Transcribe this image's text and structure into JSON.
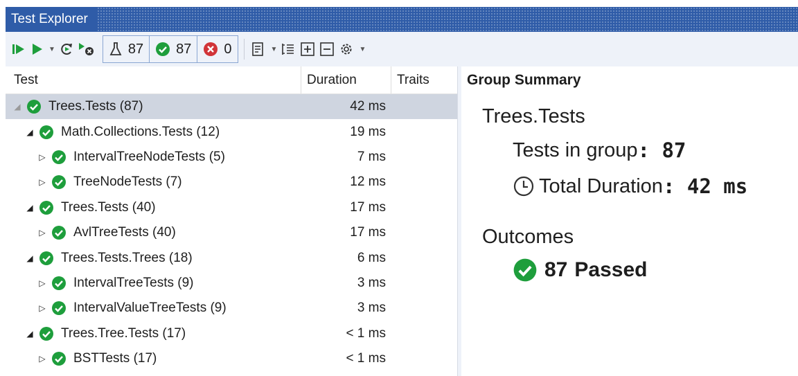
{
  "window": {
    "title": "Test Explorer"
  },
  "toolbar": {
    "counters": {
      "total": "87",
      "passed": "87",
      "failed": "0"
    }
  },
  "tree": {
    "columns": {
      "test": "Test",
      "duration": "Duration",
      "traits": "Traits"
    },
    "rows": [
      {
        "name": "Trees.Tests (87)",
        "duration": "42 ms"
      },
      {
        "name": "Math.Collections.Tests (12)",
        "duration": "19 ms"
      },
      {
        "name": "IntervalTreeNodeTests (5)",
        "duration": "7 ms"
      },
      {
        "name": "TreeNodeTests (7)",
        "duration": "12 ms"
      },
      {
        "name": "Trees.Tests (40)",
        "duration": "17 ms"
      },
      {
        "name": "AvlTreeTests (40)",
        "duration": "17 ms"
      },
      {
        "name": "Trees.Tests.Trees (18)",
        "duration": "6 ms"
      },
      {
        "name": "IntervalTreeTests (9)",
        "duration": "3 ms"
      },
      {
        "name": "IntervalValueTreeTests (9)",
        "duration": "3 ms"
      },
      {
        "name": "Trees.Tree.Tests (17)",
        "duration": "< 1 ms"
      },
      {
        "name": "BSTTests (17)",
        "duration": "< 1 ms"
      }
    ]
  },
  "summary": {
    "header": "Group Summary",
    "group_name": "Trees.Tests",
    "tests_label": "Tests in group",
    "tests_value": "87",
    "duration_label": "Total Duration",
    "duration_value": "42 ms",
    "outcomes_label": "Outcomes",
    "passed_count": "87",
    "passed_label": "Passed"
  },
  "colors": {
    "accent": "#2f5ca8",
    "pass": "#1e9e3c",
    "fail": "#d13438",
    "selection": "#cfd5e0"
  }
}
